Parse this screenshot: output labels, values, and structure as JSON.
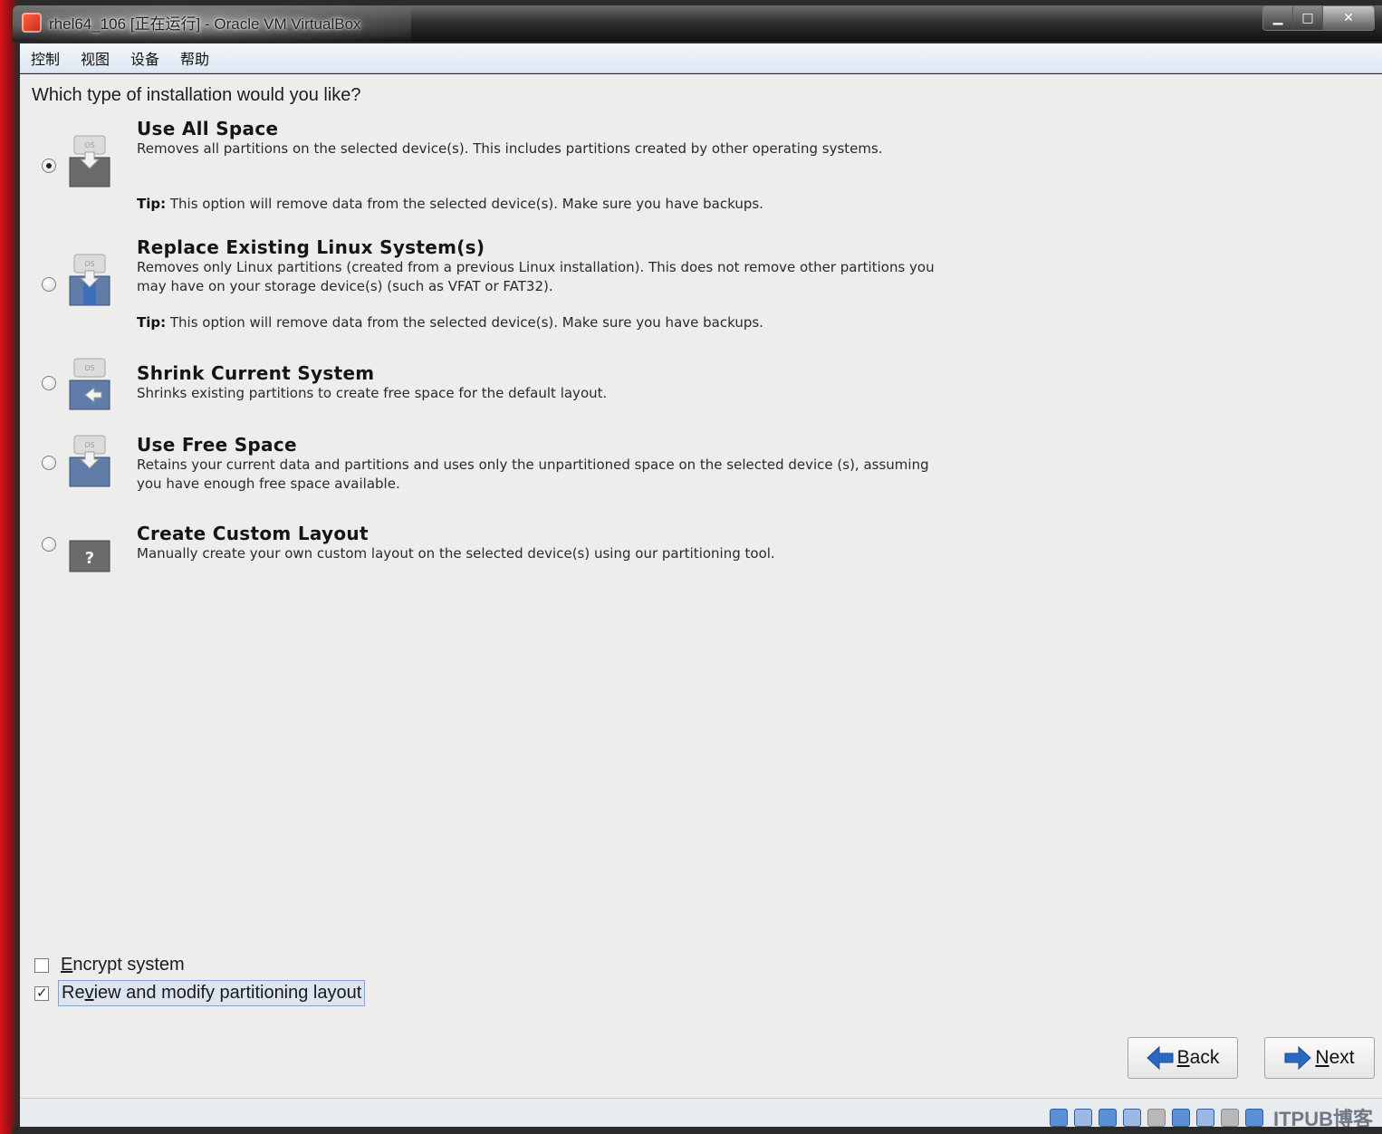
{
  "window": {
    "title": "rhel64_106 [正在运行] - Oracle VM VirtualBox",
    "controls": [
      "minimize",
      "maximize",
      "close"
    ]
  },
  "menubar": {
    "items": [
      "控制",
      "视图",
      "设备",
      "帮助"
    ]
  },
  "installer": {
    "question": "Which type of installation would you like?",
    "options": [
      {
        "title": "Use All Space",
        "description": "Removes all partitions on the selected device(s).  This includes partitions created by other operating systems.",
        "tip_label": "Tip:",
        "tip": " This option will remove data from the selected device(s).  Make sure you have backups.",
        "selected": true,
        "icon": "use-all-space-icon"
      },
      {
        "title": "Replace Existing Linux System(s)",
        "description": "Removes only Linux partitions (created from a previous Linux installation).  This does not remove other partitions you may have on your storage device(s) (such as VFAT or FAT32).",
        "tip_label": "Tip:",
        "tip": " This option will remove data from the selected device(s).  Make sure you have backups.",
        "selected": false,
        "icon": "replace-linux-icon"
      },
      {
        "title": "Shrink Current System",
        "description": "Shrinks existing partitions to create free space for the default layout.",
        "selected": false,
        "icon": "shrink-system-icon"
      },
      {
        "title": "Use Free Space",
        "description": "Retains your current data and partitions and uses only the unpartitioned space on the selected device (s), assuming you have enough free space available.",
        "selected": false,
        "icon": "use-free-space-icon"
      },
      {
        "title": "Create Custom Layout",
        "description": "Manually create your own custom layout on the selected device(s) using our partitioning tool.",
        "selected": false,
        "icon": "custom-layout-icon"
      }
    ],
    "encrypt": {
      "mnemonic": "E",
      "rest": "ncrypt system",
      "checked": false
    },
    "review": {
      "pre": "Re",
      "mnemonic": "v",
      "rest": "iew and modify partitioning layout",
      "checked": true
    },
    "back_button": {
      "mnemonic": "B",
      "rest": "ack"
    },
    "next_button": {
      "mnemonic": "N",
      "rest": "ext"
    }
  },
  "statusbar": {
    "watermark": "ITPUB博客"
  },
  "colors": {
    "frame_red": "#d8141a",
    "content_bg": "#ededeb",
    "menubar_bg": "#e4ebf4",
    "arrow_blue": "#2c67c4"
  }
}
